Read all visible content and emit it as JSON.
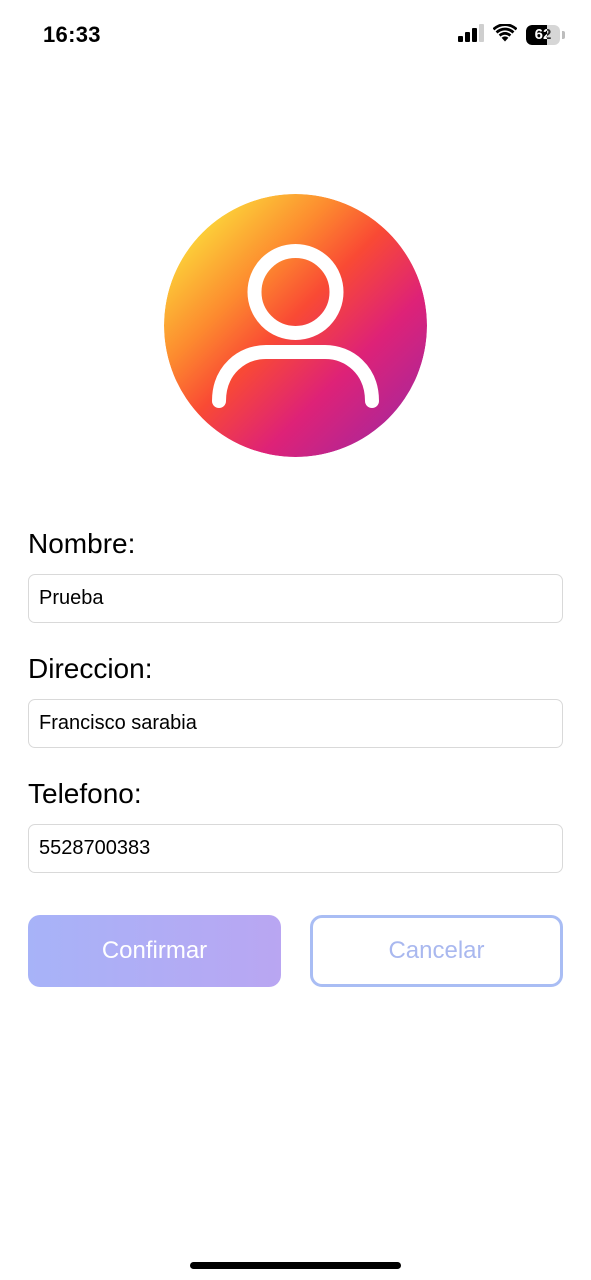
{
  "status_bar": {
    "time": "16:33",
    "battery_level": "62",
    "battery_fraction": 0.62,
    "icons": [
      "cellular-signal-icon",
      "wifi-icon",
      "battery-icon"
    ]
  },
  "avatar": {
    "icon": "user-profile-icon",
    "gradient_colors": [
      "#fbe53c",
      "#fd8a2f",
      "#f94a34",
      "#de2277",
      "#a127a0"
    ]
  },
  "form": {
    "nombre": {
      "label": "Nombre:",
      "value": "Prueba"
    },
    "direccion": {
      "label": "Direccion:",
      "value": "Francisco sarabia"
    },
    "telefono": {
      "label": "Telefono:",
      "value": "5528700383"
    }
  },
  "buttons": {
    "confirm_label": "Confirmar",
    "cancel_label": "Cancelar",
    "confirm_gradient": [
      "#a7b3f8",
      "#b9a6f2"
    ],
    "cancel_border_color": "#a9bdf4"
  }
}
